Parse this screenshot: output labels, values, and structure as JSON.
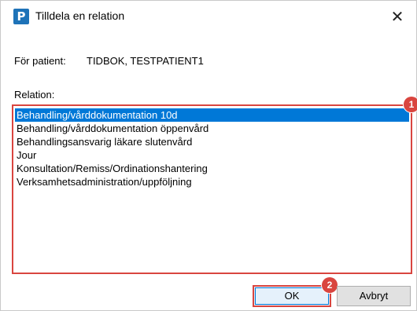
{
  "window": {
    "title": "Tilldela en relation",
    "app_icon_letter": "P",
    "close_glyph": "✕"
  },
  "patient": {
    "label": "För patient:",
    "name": "TIDBOK, TESTPATIENT1"
  },
  "relation": {
    "label": "Relation:",
    "items": [
      "Behandling/vårddokumentation 10d",
      "Behandling/vårddokumentation öppenvård",
      "Behandlingsansvarig läkare slutenvård",
      "Jour",
      "Konsultation/Remiss/Ordinationshantering",
      "Verksamhetsadministration/uppföljning"
    ],
    "selected_index": 0
  },
  "annotations": {
    "badge_1": "1",
    "badge_2": "2"
  },
  "buttons": {
    "ok_label": "OK",
    "cancel_label": "Avbryt"
  },
  "colors": {
    "selection": "#0078d7",
    "highlight": "#d9453f",
    "app_icon": "#1e73b8"
  }
}
